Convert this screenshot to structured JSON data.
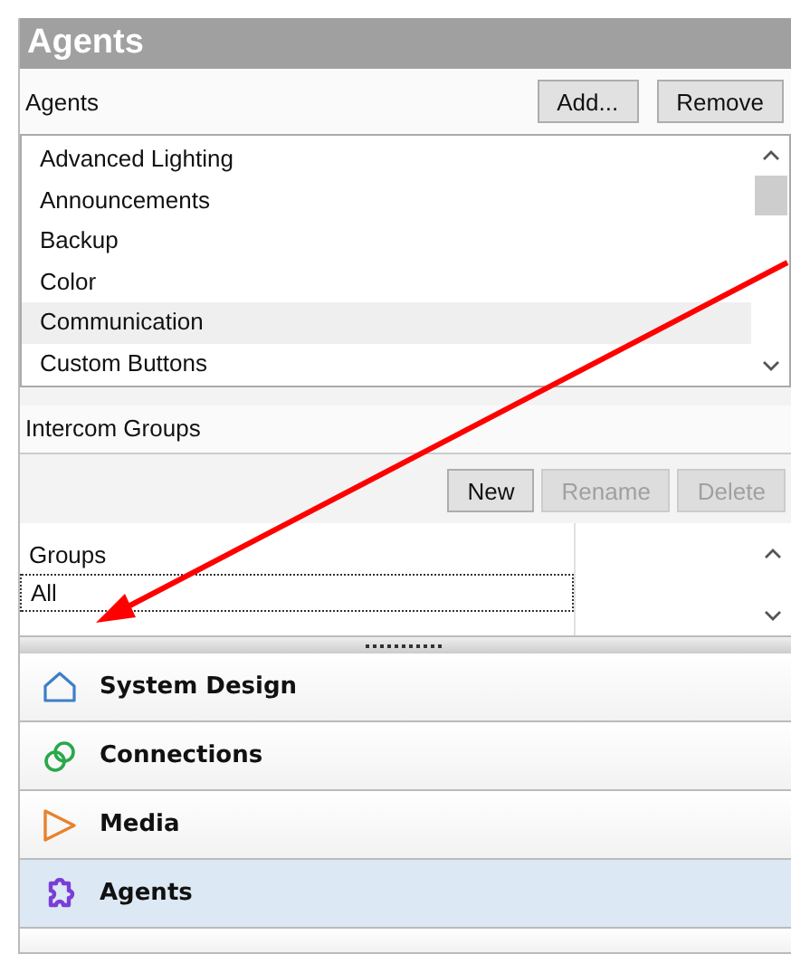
{
  "panel": {
    "title": "Agents"
  },
  "agents": {
    "label": "Agents",
    "buttons": [
      {
        "label": "Add...",
        "disabled": false
      },
      {
        "label": "Remove",
        "disabled": false
      }
    ],
    "items": [
      {
        "label": "Advanced Lighting",
        "selected": false
      },
      {
        "label": "Announcements",
        "selected": false
      },
      {
        "label": "Backup",
        "selected": false
      },
      {
        "label": "Color",
        "selected": false
      },
      {
        "label": "Communication",
        "selected": true
      },
      {
        "label": "Custom Buttons",
        "selected": false
      }
    ]
  },
  "intercom_groups": {
    "label": "Intercom Groups",
    "buttons": [
      {
        "label": "New",
        "disabled": false
      },
      {
        "label": "Rename",
        "disabled": true
      },
      {
        "label": "Delete",
        "disabled": true
      }
    ],
    "header": "Groups",
    "items": [
      {
        "label": "All",
        "selected": true
      }
    ]
  },
  "nav": [
    {
      "label": "System Design",
      "kind": "house",
      "selected": false
    },
    {
      "label": "Connections",
      "kind": "link",
      "selected": false
    },
    {
      "label": "Media",
      "kind": "play",
      "selected": false
    },
    {
      "label": "Agents",
      "kind": "puzzle",
      "selected": true
    }
  ]
}
